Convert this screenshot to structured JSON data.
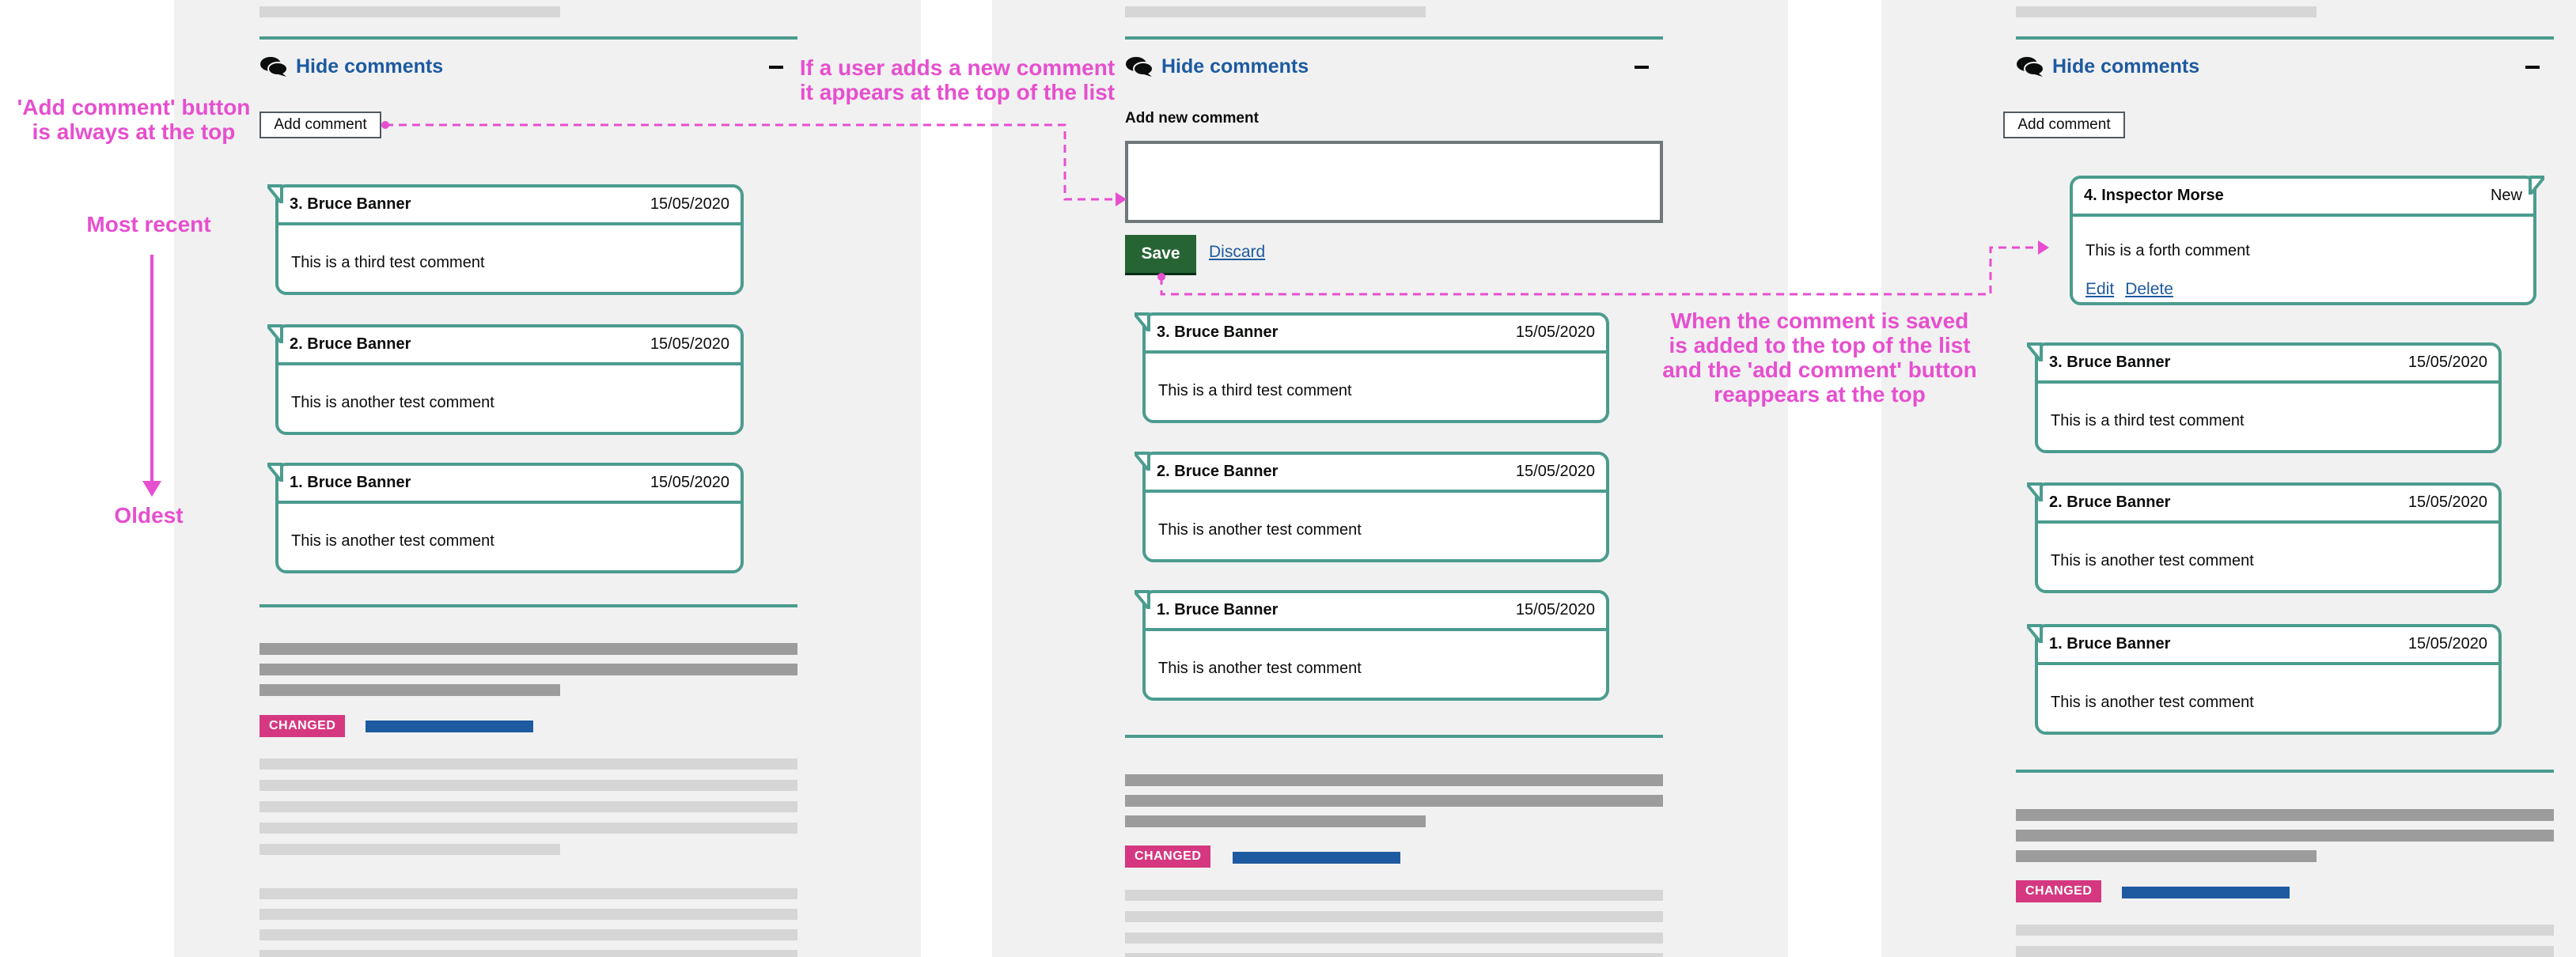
{
  "comments_heading": {
    "hide_label": "Hide comments",
    "add_comment_label": "Add comment"
  },
  "existing_comments": [
    {
      "number": "3.",
      "author": "Bruce Banner",
      "date": "15/05/2020",
      "text": "This is a third test comment"
    },
    {
      "number": "2.",
      "author": "Bruce Banner",
      "date": "15/05/2020",
      "text": "This is another test comment"
    },
    {
      "number": "1.",
      "author": "Bruce Banner",
      "date": "15/05/2020",
      "text": "This is another test comment"
    }
  ],
  "new_comment_form": {
    "label": "Add new comment",
    "value": "",
    "save_label": "Save",
    "discard_label": "Discard"
  },
  "saved_comment": {
    "number": "4.",
    "author": "Inspector Morse",
    "badge": "New",
    "text": "This is a forth comment",
    "edit_label": "Edit",
    "delete_label": "Delete"
  },
  "status_tag": "CHANGED",
  "annotations": {
    "add_button_position": "'Add comment' button\nis always at the top",
    "most_recent": "Most recent",
    "oldest": "Oldest",
    "new_comment_position": "If a user adds a new comment\nit appears at the top of the list",
    "saved_behaviour": "When the comment is saved\nis added to the top of the list\nand the 'add comment' button\nreappears at the top"
  },
  "colors": {
    "card_border": "#4b9c8e",
    "link_blue": "#1d5aa0",
    "annotation_pink": "#e64fcf",
    "changed_tag": "#d53880",
    "save_green": "#276434"
  },
  "icons": {
    "comments": "speech-bubbles-icon",
    "collapse": "minus-icon",
    "arrow": "arrow-icon"
  }
}
